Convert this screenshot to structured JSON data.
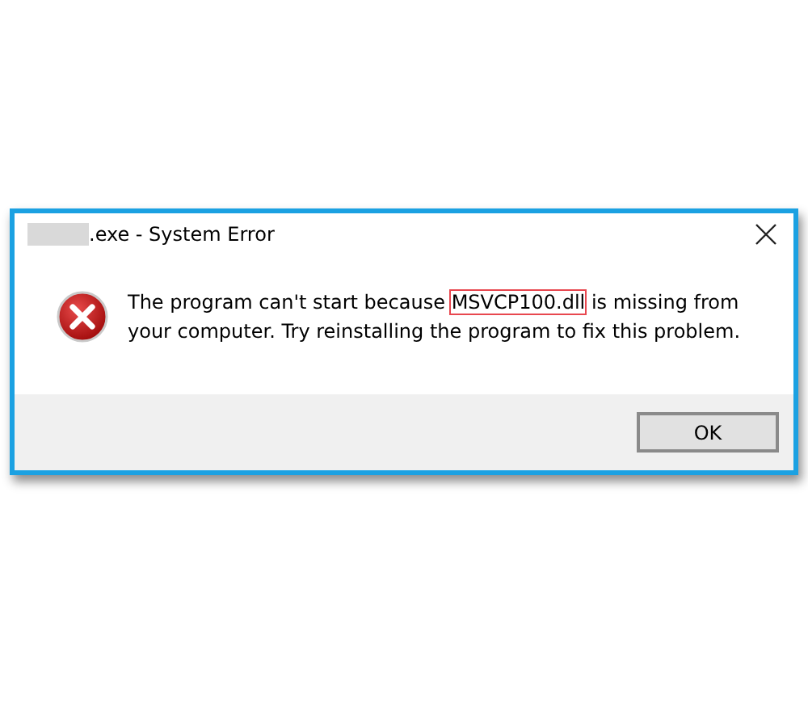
{
  "window": {
    "title": ".exe - System Error",
    "title_redacted": true
  },
  "message": {
    "before": "The program can't start because ",
    "highlighted": "MSVCP100.dll",
    "after": " is missing from your computer. Try reinstalling the program to fix this problem."
  },
  "buttons": [
    {
      "label": "OK",
      "default": true
    }
  ]
}
